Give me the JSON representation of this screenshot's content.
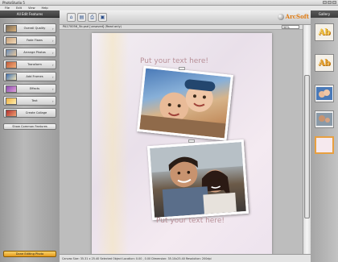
{
  "app": {
    "title": "PhotoStudio 5"
  },
  "menu": [
    "File",
    "Edit",
    "View",
    "Help"
  ],
  "left_panel": {
    "header": "All Edit Features",
    "items": [
      {
        "label": "Overall Quality"
      },
      {
        "label": "Fade Flaws"
      },
      {
        "label": "Arrange Photos"
      },
      {
        "label": "Transform"
      },
      {
        "label": "Add Frames"
      },
      {
        "label": "Effects"
      },
      {
        "label": "Text"
      }
    ],
    "create_collage": "Create Collage",
    "show_common": "Show Common Features",
    "done": "Done Editing Photo"
  },
  "toolbar": {
    "icons": [
      "home-icon",
      "open-icon",
      "print-icon",
      "save-icon"
    ],
    "logo": "ArcSoft"
  },
  "document": {
    "name": "PA170056_5b.psd [unsaved] (Read only)",
    "zoom": "50%"
  },
  "canvas": {
    "text_top": "Put your text here!",
    "text_bottom": "Put your text here!"
  },
  "gallery": {
    "header": "Gallery",
    "item_text": "Ab"
  },
  "statusbar": {
    "text": "Canvas Size: 35.31 x 25.40   Selected Object Location: 0.00 , 0.00 Dimension: 35.10x25.40 Resolution: 200dpi"
  }
}
